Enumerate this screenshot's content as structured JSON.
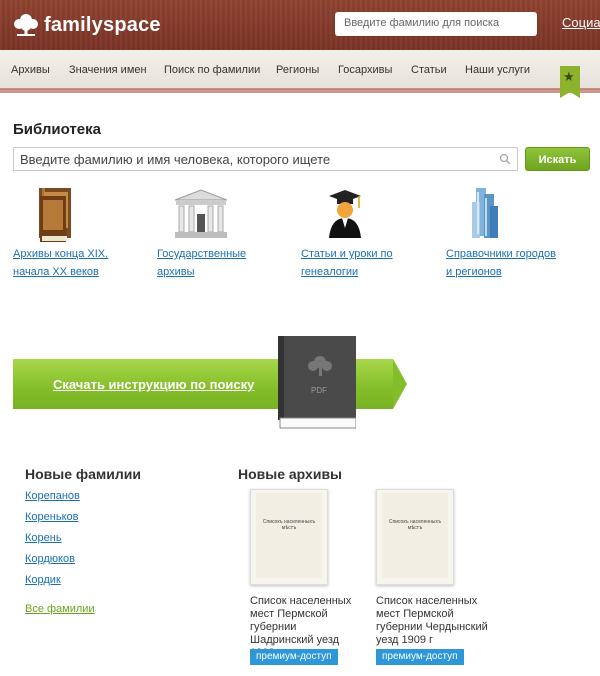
{
  "header": {
    "logo_text": "familyspace",
    "search_placeholder": "Введите фамилию для поиска",
    "social_link": "Социа"
  },
  "nav": {
    "items": [
      "Архивы",
      "Значения имен",
      "Поиск по фамилии",
      "Регионы",
      "Госархивы",
      "Статьи",
      "Наши услуги"
    ]
  },
  "library": {
    "title": "Библиотека",
    "search_placeholder": "Введите фамилию и имя человека, которого ищете",
    "search_button": "Искать",
    "categories": [
      {
        "label_line1": "Архивы конца XIX,",
        "label_line2": "начала XX веков",
        "icon": "books-icon"
      },
      {
        "label_line1": "Государственные",
        "label_line2": "архивы",
        "icon": "building-icon"
      },
      {
        "label_line1": "Статьи и уроки по",
        "label_line2": "генеалогии",
        "icon": "graduate-icon"
      },
      {
        "label_line1": "Справочники городов",
        "label_line2": "и регионов",
        "icon": "skyscraper-icon"
      }
    ]
  },
  "banner": {
    "text": "Скачать инструкцию по поиску",
    "book_label": "PDF"
  },
  "new_surnames": {
    "title": "Новые фамилии",
    "items": [
      "Корепанов",
      "Кореньков",
      "Корень",
      "Кордюков",
      "Кордик"
    ],
    "all_link": "Все фамилии"
  },
  "new_archives": {
    "title": "Новые архивы",
    "items": [
      {
        "name": "Список населенных мест Пермской губернии Шадринский уезд 1908 г",
        "badge": "премиум-доступ",
        "thumb_text": "Списокъ населенныхъ мѣстъ"
      },
      {
        "name": "Список населенных мест Пермской губернии Чердынский уезд 1909 г",
        "badge": "премиум-доступ",
        "thumb_text": "Списокъ населенныхъ мѣстъ"
      }
    ]
  }
}
